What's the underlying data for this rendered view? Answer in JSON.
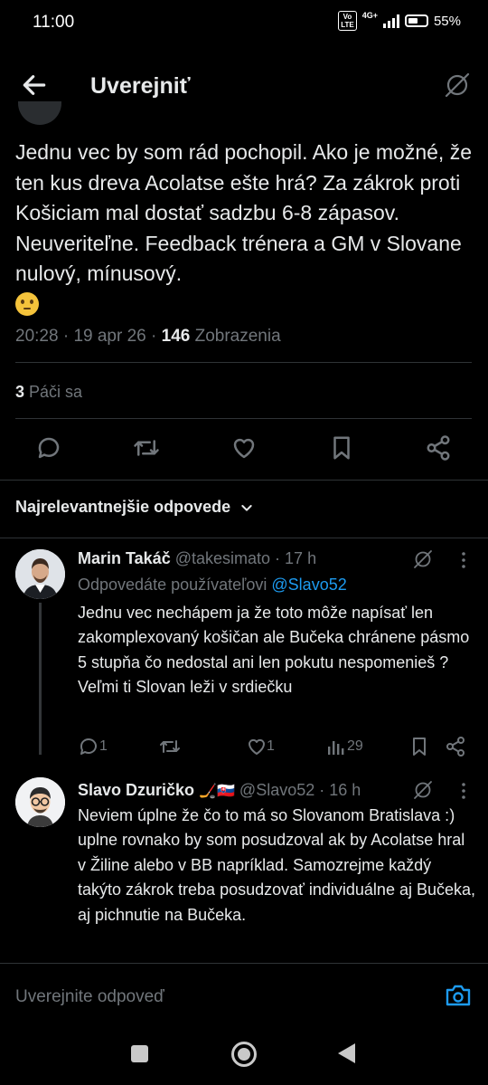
{
  "status_bar": {
    "time": "11:00",
    "volte": "Vo LTE",
    "network": "4G+",
    "battery": "55%"
  },
  "header": {
    "title": "Uverejniť"
  },
  "tweet": {
    "text": "Jednu vec by som rád pochopil. Ako je možné, že ten kus dreva Acolatse ešte hrá? Za zákrok proti Košiciam mal dostať sadzbu 6-8 zápasov. Neuveriteľne. Feedback trénera a GM v Slovane nulový, mínusový.",
    "emoji": "thinking-face",
    "time": "20:28",
    "date": "19 apr 26",
    "views_count": "146",
    "views_label": "Zobrazenia",
    "likes_count": "3",
    "likes_label": "Páči sa"
  },
  "sort_label": "Najrelevantnejšie odpovede",
  "replies": [
    {
      "name": "Marin Takáč",
      "handle": "@takesimato · 17 h",
      "replying_prefix": "Odpovedáte používateľovi",
      "replying_to": "@Slavo52",
      "text": "Jednu vec nechápem ja že toto môže napísať len zakomplexovaný košičan ale Bučeka chránene pásmo 5 stupňa čo nedostal ani len pokutu nespomenieš ? Veľmi ti Slovan leži v srdiečku",
      "replies_count": "1",
      "likes_count": "1",
      "views_count": "29"
    },
    {
      "name": "Slavo Dzuričko",
      "name_emoji": "🏒🇸🇰",
      "handle": "@Slavo52 · 16 h",
      "text": "Neviem úplne že čo to má so Slovanom Bratislava :) uplne rovnako by som posudzoval ak by Acolatse hral v Žiline alebo v BB napríklad. Samozrejme každý takýto zákrok treba posudzovať individuálne aj Bučeka, aj pichnutie na Bučeka."
    }
  ],
  "composer": {
    "placeholder": "Uverejnite odpoveď"
  },
  "colors": {
    "accent": "#1d9bf0",
    "muted": "#71767b",
    "text": "#e7e9ea",
    "background": "#000000"
  }
}
